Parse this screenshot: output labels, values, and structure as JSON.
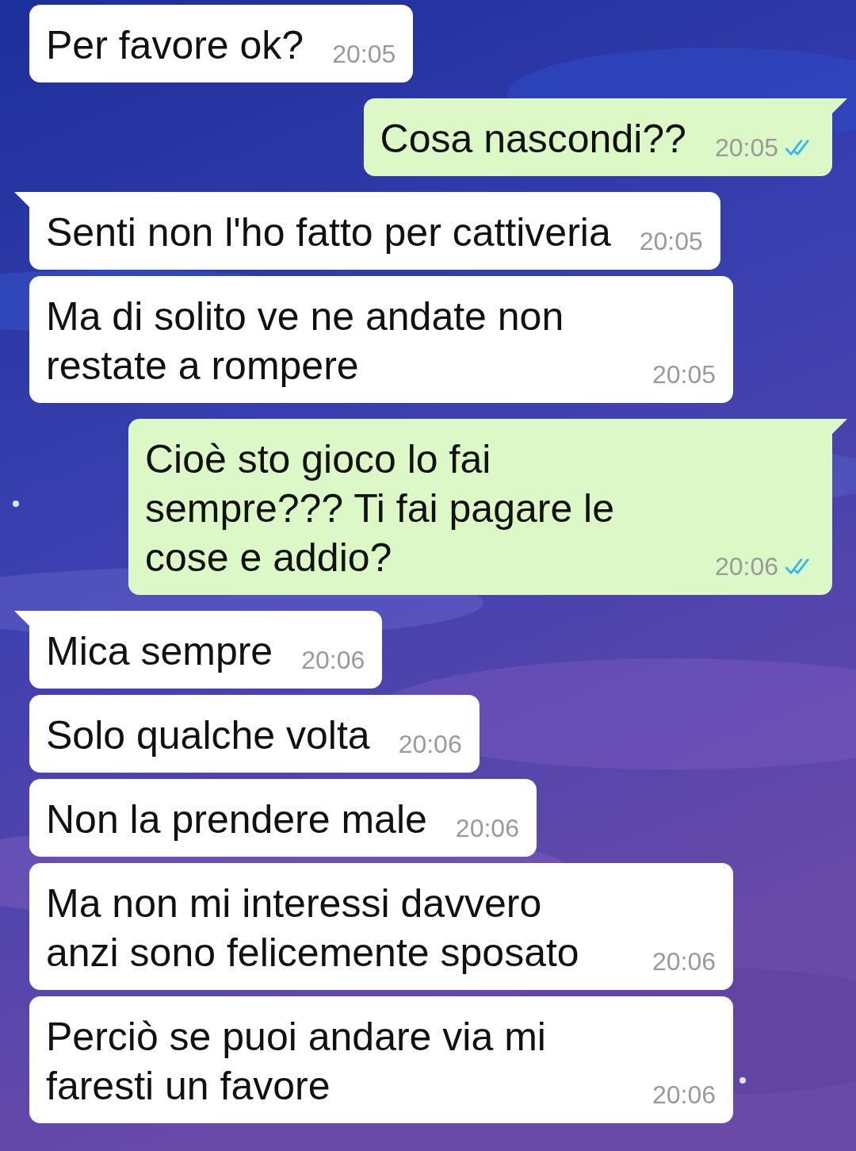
{
  "messages": [
    {
      "kind": "in",
      "tail": false,
      "text": "Per favore ok?",
      "time": "20:05"
    },
    {
      "kind": "out",
      "tail": true,
      "text": "Cosa nascondi??",
      "time": "20:05",
      "read": true
    },
    {
      "kind": "in",
      "tail": true,
      "text": "Senti non l'ho fatto per cattiveria",
      "time": "20:05"
    },
    {
      "kind": "in",
      "tail": false,
      "text": "Ma di solito ve ne andate non restate a rompere",
      "time": "20:05"
    },
    {
      "kind": "out",
      "tail": true,
      "text": "Cioè sto gioco lo fai sempre??? Ti fai pagare le cose e addio?",
      "time": "20:06",
      "read": true
    },
    {
      "kind": "in",
      "tail": true,
      "text": "Mica sempre",
      "time": "20:06"
    },
    {
      "kind": "in",
      "tail": false,
      "text": "Solo qualche volta",
      "time": "20:06"
    },
    {
      "kind": "in",
      "tail": false,
      "text": "Non la prendere male",
      "time": "20:06"
    },
    {
      "kind": "in",
      "tail": false,
      "text": "Ma non mi interessi davvero anzi sono felicemente sposato",
      "time": "20:06"
    },
    {
      "kind": "in",
      "tail": false,
      "text": "Perciò se puoi andare via mi faresti un favore",
      "time": "20:06"
    }
  ]
}
